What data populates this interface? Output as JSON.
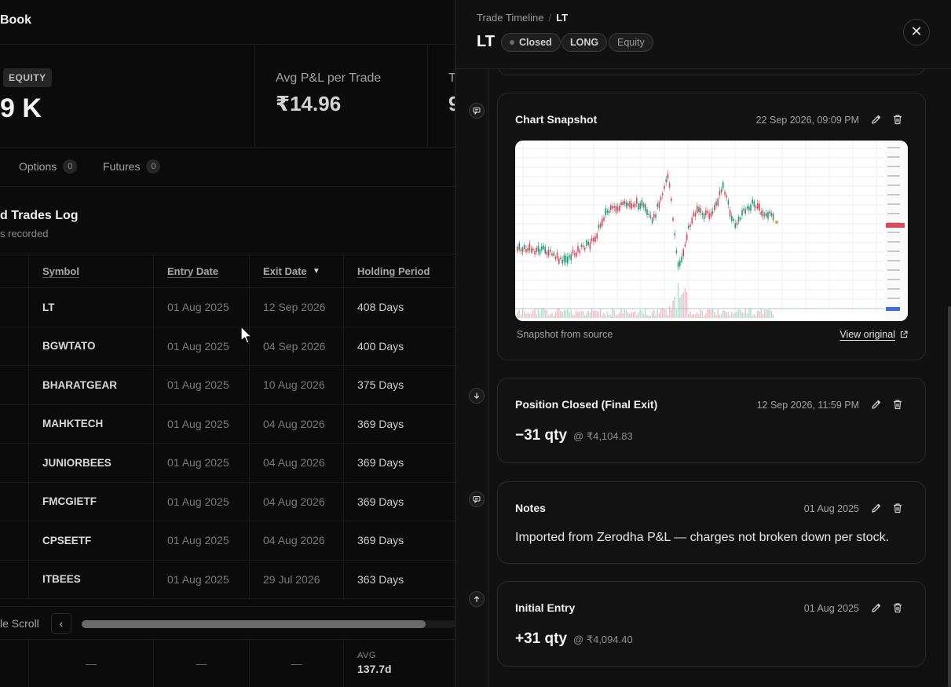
{
  "background": {
    "header_title": "Book",
    "stats": {
      "tag": "EQUITY",
      "value1": "9 K",
      "label2": "Avg P&L per Trade",
      "value2": "₹14.96",
      "label3": "T",
      "value3": "9"
    },
    "tabs": [
      {
        "label": "Options",
        "count": "0"
      },
      {
        "label": "Futures",
        "count": "0"
      }
    ],
    "log_title": "d Trades Log",
    "log_subtitle": "s recorded",
    "table": {
      "headers": [
        "Symbol",
        "Entry Date",
        "Exit Date",
        "Holding Period"
      ],
      "sort_indicator": "▼",
      "rows": [
        [
          "LT",
          "01 Aug 2025",
          "12 Sep 2026",
          "408 Days"
        ],
        [
          "BGWTATO",
          "01 Aug 2025",
          "04 Sep 2026",
          "400 Days"
        ],
        [
          "BHARATGEAR",
          "01 Aug 2025",
          "10 Aug 2026",
          "375 Days"
        ],
        [
          "MAHKTECH",
          "01 Aug 2025",
          "04 Aug 2026",
          "369 Days"
        ],
        [
          "JUNIORBEES",
          "01 Aug 2025",
          "04 Aug 2026",
          "369 Days"
        ],
        [
          "FMCGIETF",
          "01 Aug 2025",
          "04 Aug 2026",
          "369 Days"
        ],
        [
          "CPSEETF",
          "01 Aug 2025",
          "04 Aug 2026",
          "369 Days"
        ],
        [
          "ITBEES",
          "01 Aug 2025",
          "29 Jul 2026",
          "363 Days"
        ]
      ]
    },
    "hscroll": {
      "label": "le Scroll",
      "prev": "‹",
      "thumb_fraction": 0.92
    },
    "footer": {
      "dash": "—",
      "avg_label": "AVG",
      "avg_value": "137.7d"
    }
  },
  "drawer": {
    "breadcrumb": {
      "root": "Trade Timeline",
      "sep": "/",
      "current": "LT"
    },
    "title": "LT",
    "badges": {
      "status": "Closed",
      "side": "LONG",
      "segment": "Equity"
    },
    "close_glyph": "✕",
    "events": {
      "chart": {
        "title": "Chart Snapshot",
        "date": "22 Sep 2026, 09:09 PM",
        "source_label": "Snapshot from source",
        "view_original": "View original"
      },
      "closed": {
        "title": "Position Closed (Final Exit)",
        "date": "12 Sep 2026, 11:59 PM",
        "qty": "−31 qty",
        "price": "@ ₹4,104.83"
      },
      "notes": {
        "title": "Notes",
        "date": "01 Aug 2025",
        "text": "Imported from Zerodha P&L — charges not broken down per stock."
      },
      "entry": {
        "title": "Initial Entry",
        "date": "01 Aug 2025",
        "qty": "+31 qty",
        "price": "@ ₹4,094.40"
      }
    },
    "colors": {
      "drawer_bg": "#111111",
      "card_border": "#2b2b2b",
      "candle_up": "#1b9e77",
      "candle_down": "#e0455a"
    }
  }
}
